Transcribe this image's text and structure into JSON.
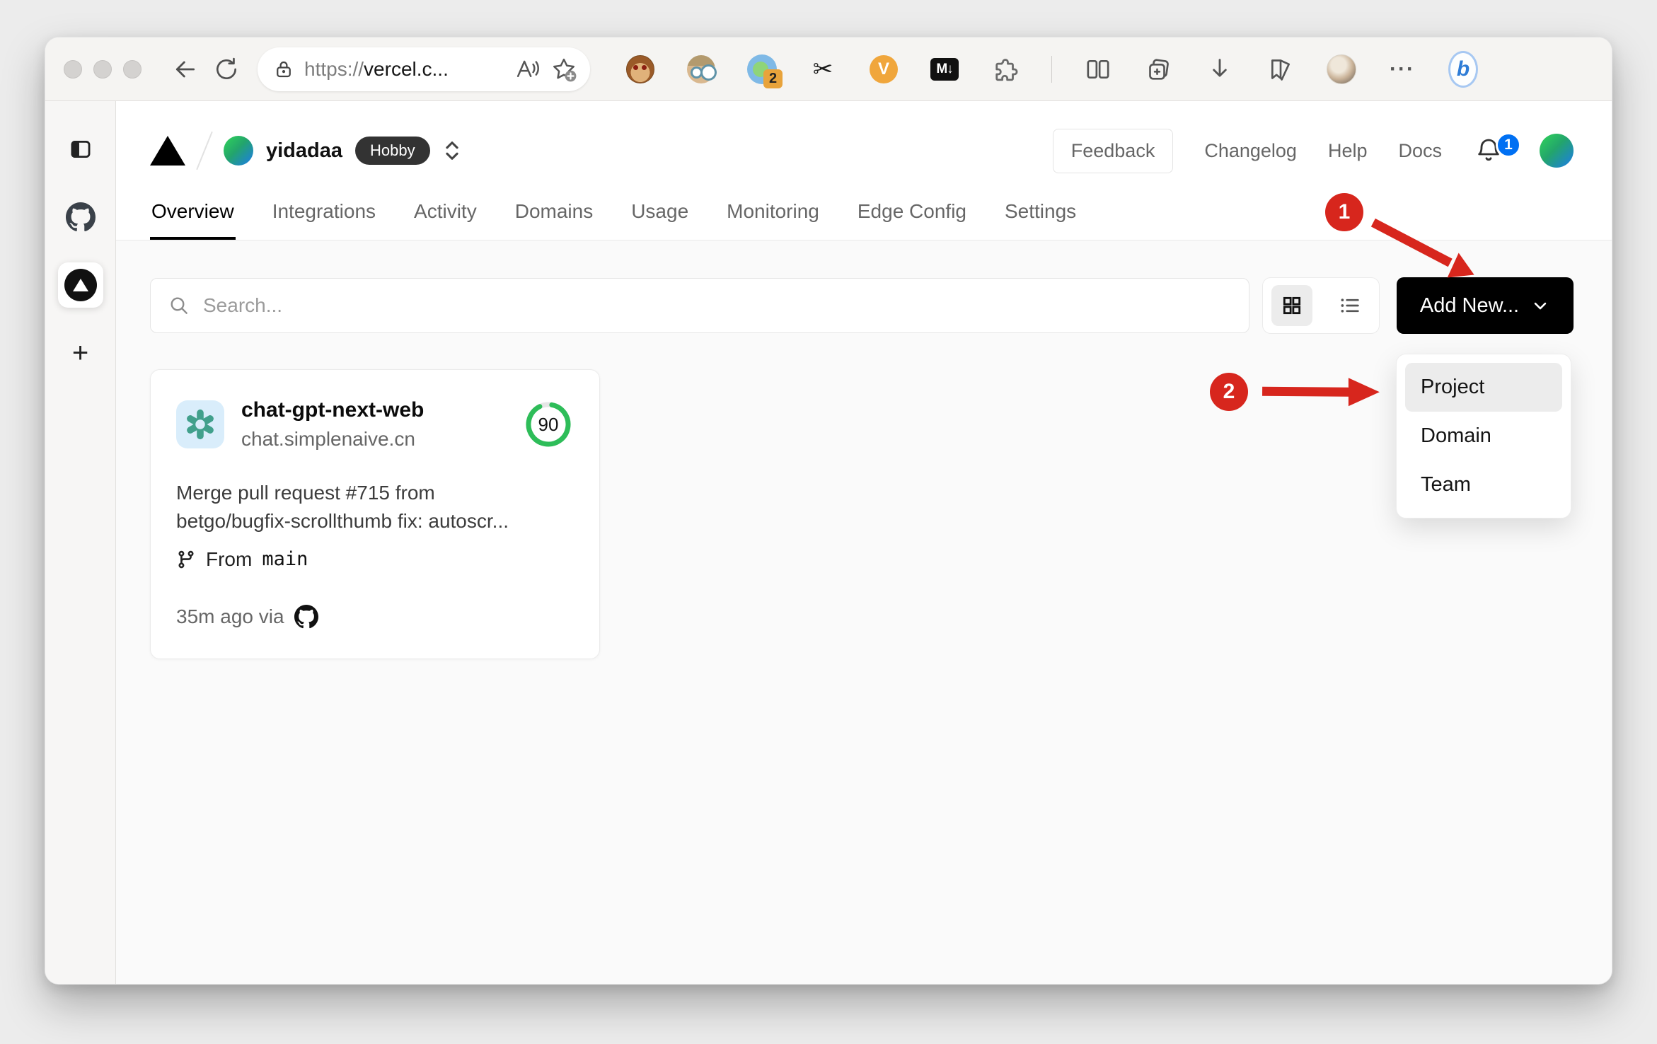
{
  "annotations": {
    "step1": "1",
    "step2": "2"
  },
  "browser": {
    "url": {
      "protocol": "https://",
      "host": "vercel.c..."
    },
    "extensions": {
      "proxy_badge": "2",
      "v_label": "V",
      "markdown_label": "M↓",
      "more": "···",
      "scissors": "✂",
      "bing": "b"
    }
  },
  "sidebar": {
    "plus": "+"
  },
  "page": {
    "team": {
      "name": "yidadaa",
      "plan": "Hobby"
    },
    "nav": {
      "feedback": "Feedback",
      "changelog": "Changelog",
      "help": "Help",
      "docs": "Docs",
      "bell_badge": "1"
    },
    "tabs": [
      {
        "label": "Overview"
      },
      {
        "label": "Integrations"
      },
      {
        "label": "Activity"
      },
      {
        "label": "Domains"
      },
      {
        "label": "Usage"
      },
      {
        "label": "Monitoring"
      },
      {
        "label": "Edge Config"
      },
      {
        "label": "Settings"
      }
    ],
    "toolbar": {
      "search_placeholder": "Search...",
      "add_new": "Add New..."
    },
    "add_menu": {
      "items": [
        {
          "label": "Project"
        },
        {
          "label": "Domain"
        },
        {
          "label": "Team"
        }
      ]
    },
    "card": {
      "name": "chat-gpt-next-web",
      "domain": "chat.simplenaive.cn",
      "score": "90",
      "commit_line1": "Merge pull request #715 from",
      "commit_line2": "betgo/bugfix-scrollthumb fix: autoscr...",
      "branch_label": "From",
      "branch_name": "main",
      "time_via": "35m ago via"
    }
  },
  "colors": {
    "accent_red": "#d7261d",
    "vercel_blue": "#0070f3",
    "score_green": "#2ebd59",
    "button_black": "#000000"
  }
}
